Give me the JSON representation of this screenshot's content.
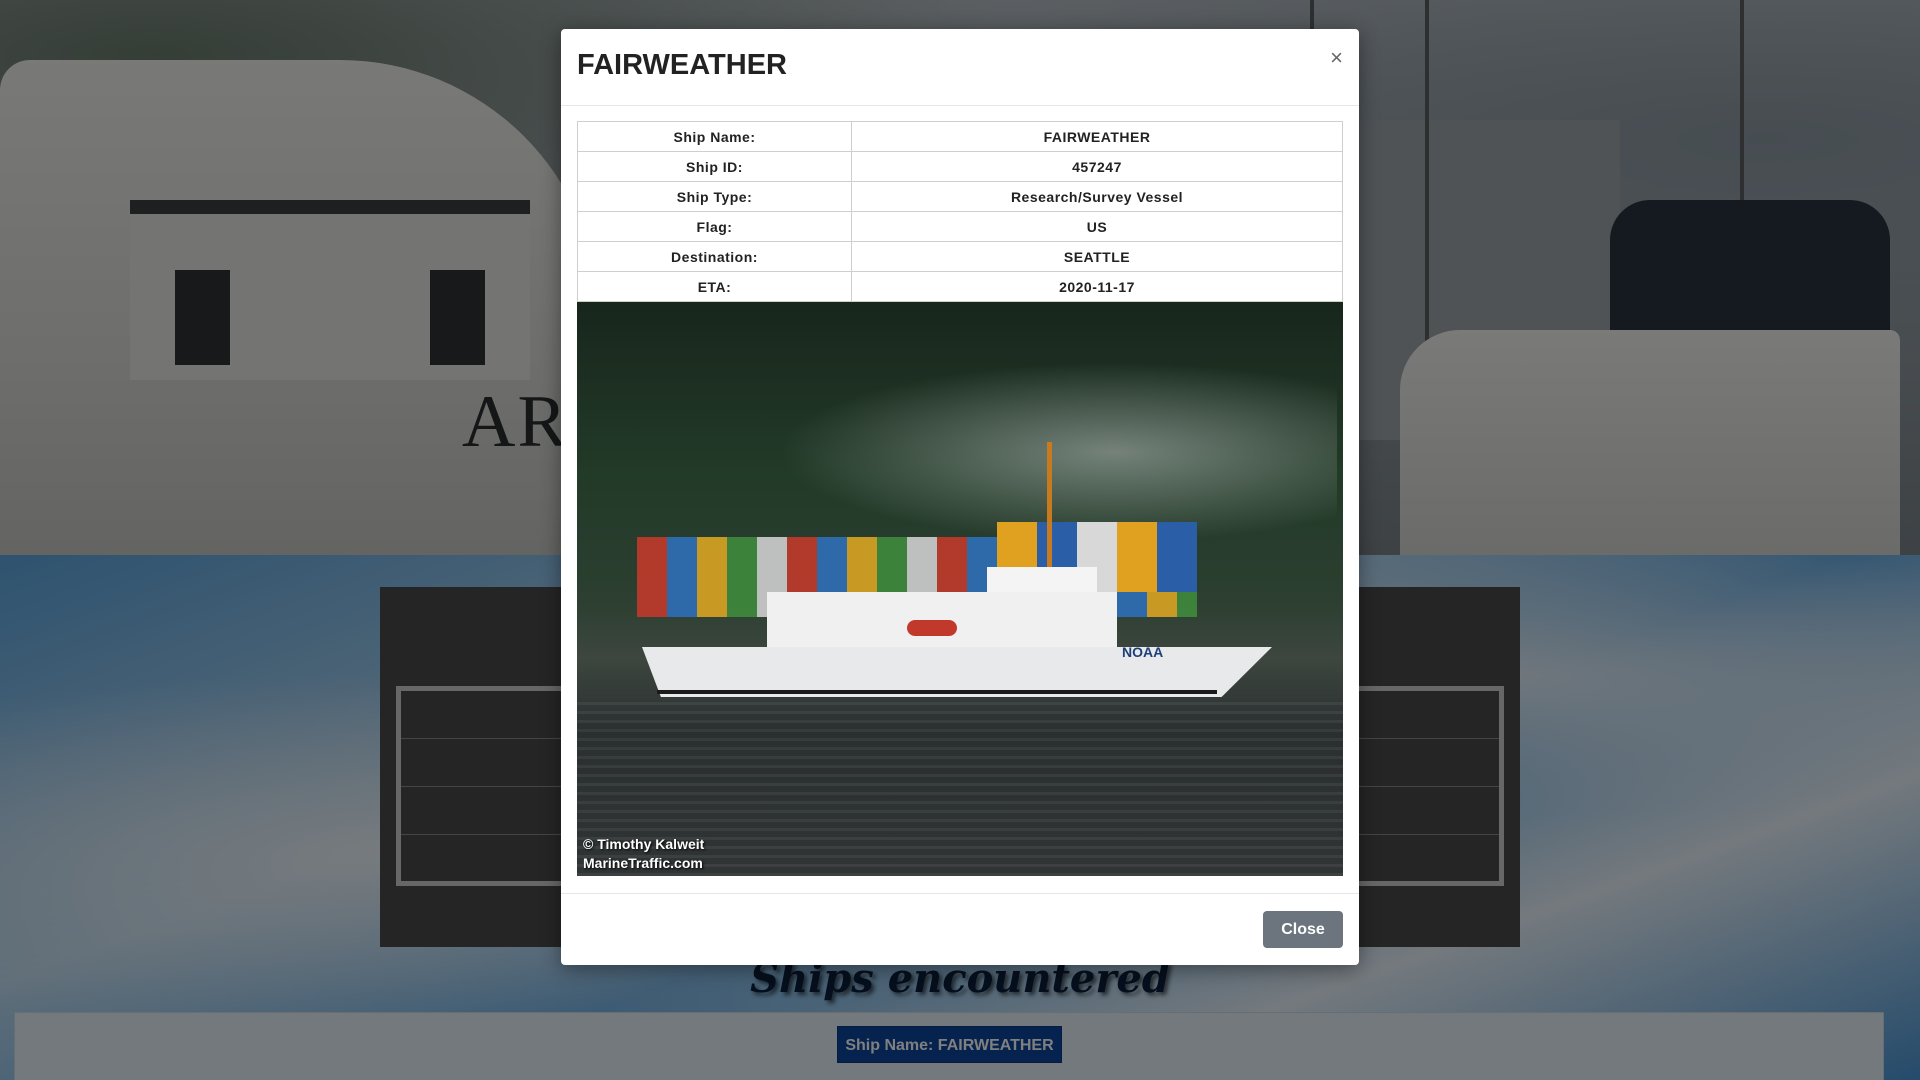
{
  "background": {
    "hero_boat_name": "AR",
    "section_heading": "Ships encountered",
    "ship_chip_label": "Ship Name: FAIRWEATHER"
  },
  "modal": {
    "title": "FAIRWEATHER",
    "close_symbol": "×",
    "rows": [
      {
        "label": "Ship Name:",
        "value": "FAIRWEATHER"
      },
      {
        "label": "Ship ID:",
        "value": "457247"
      },
      {
        "label": "Ship Type:",
        "value": "Research/Survey Vessel"
      },
      {
        "label": "Flag:",
        "value": "US"
      },
      {
        "label": "Destination:",
        "value": "SEATTLE"
      },
      {
        "label": "ETA:",
        "value": "2020-11-17"
      }
    ],
    "photo": {
      "credit_line1": "© Timothy Kalweit",
      "credit_line2": "MarineTraffic.com",
      "ship_marking": "NOAA"
    },
    "footer": {
      "close_label": "Close"
    }
  },
  "colors": {
    "chip_blue": "#0d47a1",
    "close_button_gray": "#6c757d"
  }
}
